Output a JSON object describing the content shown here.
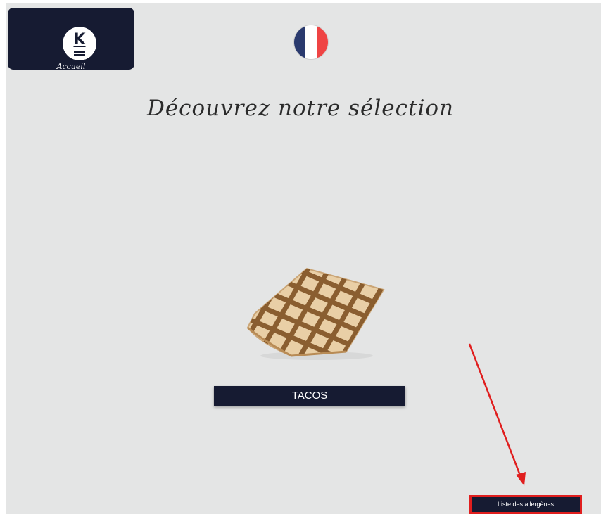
{
  "header": {
    "home_label": "Accueil",
    "logo_letter": "K",
    "language_flag": "france-flag-icon"
  },
  "main": {
    "title": "Découvrez notre sélection",
    "products": [
      {
        "name": "TACOS",
        "image": "tacos-image"
      }
    ]
  },
  "footer": {
    "allergen_button_label": "Liste des allergènes"
  },
  "colors": {
    "background": "#e4e5e5",
    "navy": "#161b32",
    "flag_blue": "#2a3a6e",
    "flag_white": "#ffffff",
    "flag_red": "#ef4444",
    "annotation_red": "#e01e1e"
  }
}
